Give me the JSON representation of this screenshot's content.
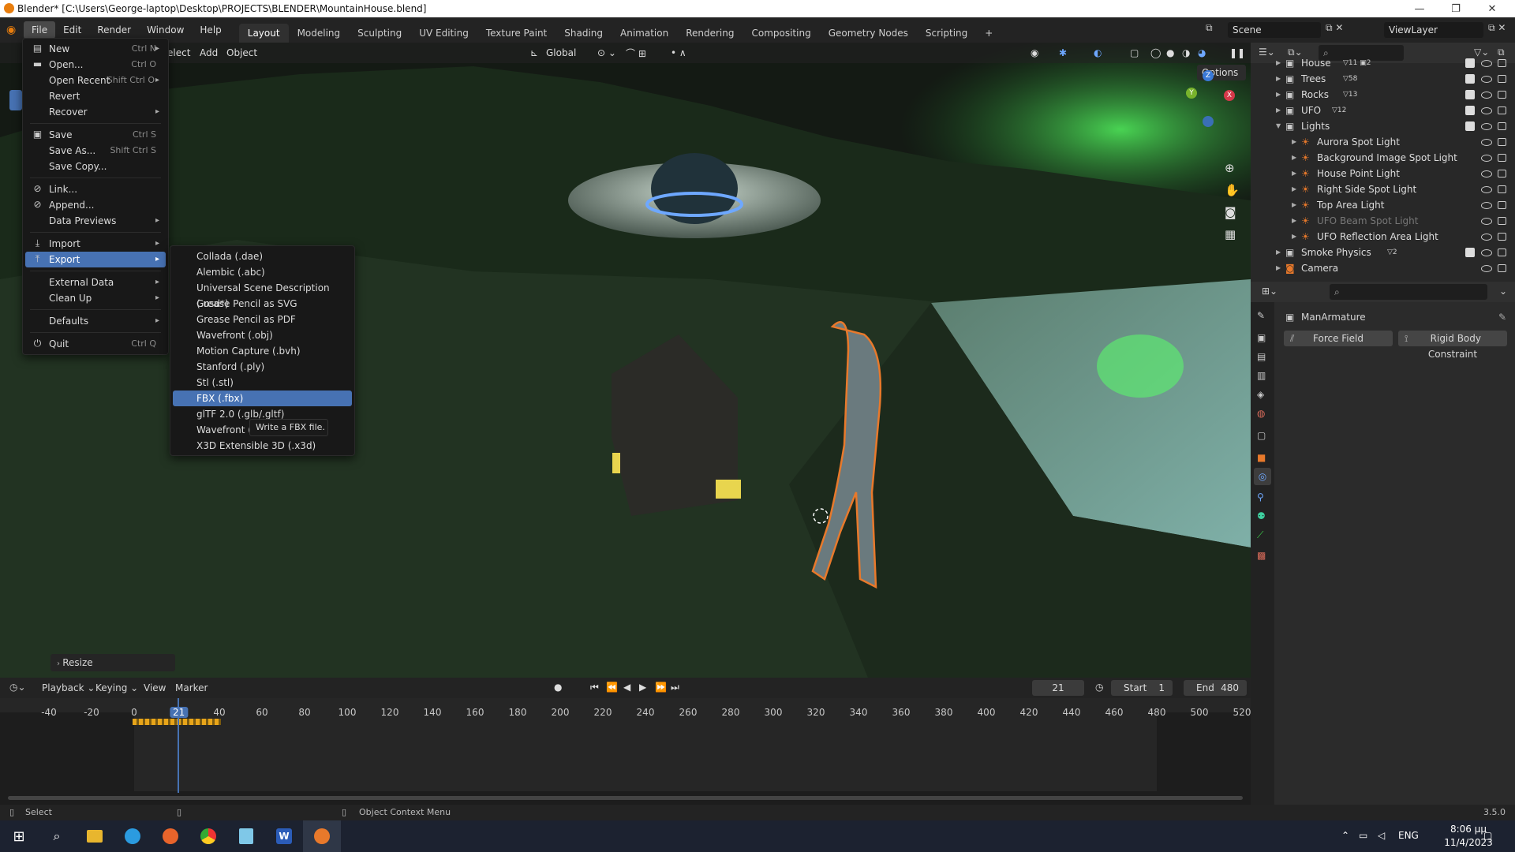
{
  "window": {
    "title": "Blender* [C:\\Users\\George-laptop\\Desktop\\PROJECTS\\BLENDER\\MountainHouse.blend]"
  },
  "topmenu": {
    "file": "File",
    "edit": "Edit",
    "render": "Render",
    "window": "Window",
    "help": "Help"
  },
  "workspaces": [
    "Layout",
    "Modeling",
    "Sculpting",
    "UV Editing",
    "Texture Paint",
    "Shading",
    "Animation",
    "Rendering",
    "Compositing",
    "Geometry Nodes",
    "Scripting",
    "+"
  ],
  "scene": {
    "label": "Scene",
    "view_layer": "ViewLayer"
  },
  "viewport_header": {
    "select": "elect",
    "add": "Add",
    "object": "Object",
    "orientation": "Global",
    "options": "Options"
  },
  "file_menu": {
    "items": [
      {
        "label": "New",
        "shortcut": "Ctrl N",
        "icon": "new-file-icon"
      },
      {
        "label": "Open...",
        "shortcut": "Ctrl O",
        "icon": "folder-icon"
      },
      {
        "label": "Open Recent",
        "shortcut": "Shift Ctrl O",
        "icon": ""
      },
      {
        "label": "Revert",
        "shortcut": "",
        "icon": ""
      },
      {
        "label": "Recover",
        "shortcut": "",
        "icon": ""
      },
      {
        "label": "Save",
        "shortcut": "Ctrl S",
        "icon": "save-icon"
      },
      {
        "label": "Save As...",
        "shortcut": "Shift Ctrl S",
        "icon": ""
      },
      {
        "label": "Save Copy...",
        "shortcut": "",
        "icon": ""
      },
      {
        "label": "Link...",
        "shortcut": "",
        "icon": "link-icon"
      },
      {
        "label": "Append...",
        "shortcut": "",
        "icon": "append-icon"
      },
      {
        "label": "Data Previews",
        "shortcut": "",
        "icon": ""
      },
      {
        "label": "Import",
        "shortcut": "",
        "icon": "import-icon"
      },
      {
        "label": "Export",
        "shortcut": "",
        "icon": "export-icon"
      },
      {
        "label": "External Data",
        "shortcut": "",
        "icon": ""
      },
      {
        "label": "Clean Up",
        "shortcut": "",
        "icon": ""
      },
      {
        "label": "Defaults",
        "shortcut": "",
        "icon": ""
      },
      {
        "label": "Quit",
        "shortcut": "Ctrl Q",
        "icon": "power-icon"
      }
    ]
  },
  "export_menu": {
    "items": [
      "Collada (.dae)",
      "Alembic (.abc)",
      "Universal Scene Description (.usd*)",
      "Grease Pencil as SVG",
      "Grease Pencil as PDF",
      "Wavefront (.obj)",
      "Motion Capture (.bvh)",
      "Stanford (.ply)",
      "Stl (.stl)",
      "FBX (.fbx)",
      "glTF 2.0 (.glb/.gltf)",
      "Wavefront (.c",
      "X3D Extensible 3D (.x3d)"
    ],
    "tooltip": "Write a FBX file."
  },
  "outliner": {
    "rows": [
      {
        "name": "House",
        "badge": "11",
        "badge2": "2"
      },
      {
        "name": "Trees",
        "badge": "58",
        "badge2": ""
      },
      {
        "name": "Rocks",
        "badge": "13",
        "badge2": ""
      },
      {
        "name": "UFO",
        "badge": "12",
        "badge2": ""
      },
      {
        "name": "Lights",
        "badge": "",
        "badge2": ""
      },
      {
        "name": "Aurora Spot Light",
        "badge": "",
        "badge2": ""
      },
      {
        "name": "Background Image Spot Light",
        "badge": "",
        "badge2": ""
      },
      {
        "name": "House Point Light",
        "badge": "",
        "badge2": ""
      },
      {
        "name": "Right Side Spot Light",
        "badge": "",
        "badge2": ""
      },
      {
        "name": "Top Area Light",
        "badge": "",
        "badge2": ""
      },
      {
        "name": "UFO Beam Spot Light",
        "badge": "",
        "badge2": ""
      },
      {
        "name": "UFO Reflection Area Light",
        "badge": "",
        "badge2": ""
      },
      {
        "name": "Smoke Physics",
        "badge": "2",
        "badge2": ""
      },
      {
        "name": "Camera",
        "badge": "",
        "badge2": ""
      }
    ]
  },
  "properties": {
    "object_name": "ManArmature",
    "force_field": "Force Field",
    "rigid_body_constraint": "Rigid Body Constraint"
  },
  "viewport": {
    "last_op": "Resize"
  },
  "timeline": {
    "menus": [
      "Playback",
      "Keying",
      "View",
      "Marker"
    ],
    "current_frame": "21",
    "start_label": "Start",
    "start": "1",
    "end_label": "End",
    "end": "480",
    "ticks": [
      "-40",
      "-20",
      "0",
      "21",
      "40",
      "60",
      "80",
      "100",
      "120",
      "140",
      "160",
      "180",
      "200",
      "220",
      "240",
      "260",
      "280",
      "300",
      "320",
      "340",
      "360",
      "380",
      "400",
      "420",
      "440",
      "460",
      "480",
      "500",
      "520"
    ]
  },
  "statusbar": {
    "left": "Select",
    "middle": "Object Context Menu",
    "version": "3.5.0"
  },
  "taskbar": {
    "lang": "ENG",
    "time": "8:06 μμ",
    "date": "11/4/2023"
  },
  "colors": {
    "accent": "#4772b3",
    "selection": "#e8792b",
    "aurora": "#3ed14a"
  }
}
